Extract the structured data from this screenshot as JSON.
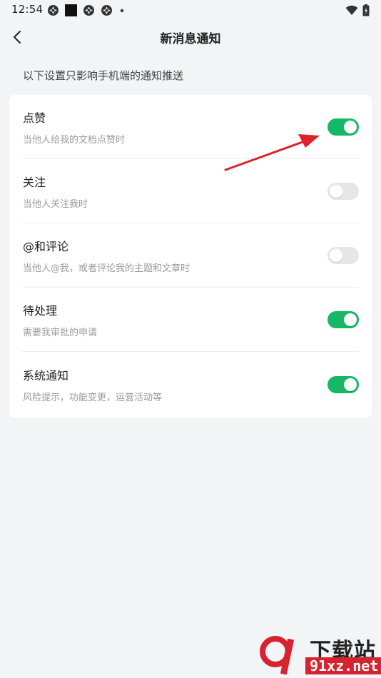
{
  "status_bar": {
    "time": "12:54"
  },
  "nav": {
    "title": "新消息通知"
  },
  "section_hint": "以下设置只影响手机端的通知推送",
  "settings": [
    {
      "title": "点赞",
      "description": "当他人给我的文档点赞时",
      "enabled": true
    },
    {
      "title": "关注",
      "description": "当他人关注我时",
      "enabled": false
    },
    {
      "title": "@和评论",
      "description": "当他人@我，或者评论我的主题和文章时",
      "enabled": false
    },
    {
      "title": "待处理",
      "description": "需要我审批的申请",
      "enabled": true
    },
    {
      "title": "系统通知",
      "description": "风险提示，功能变更，运营活动等",
      "enabled": true
    }
  ],
  "colors": {
    "toggle_on": "#17b865",
    "toggle_off": "#e6e6e6",
    "annotation_arrow": "#e0212a"
  },
  "watermark": {
    "title": "下载站",
    "url": "91xz.net"
  }
}
